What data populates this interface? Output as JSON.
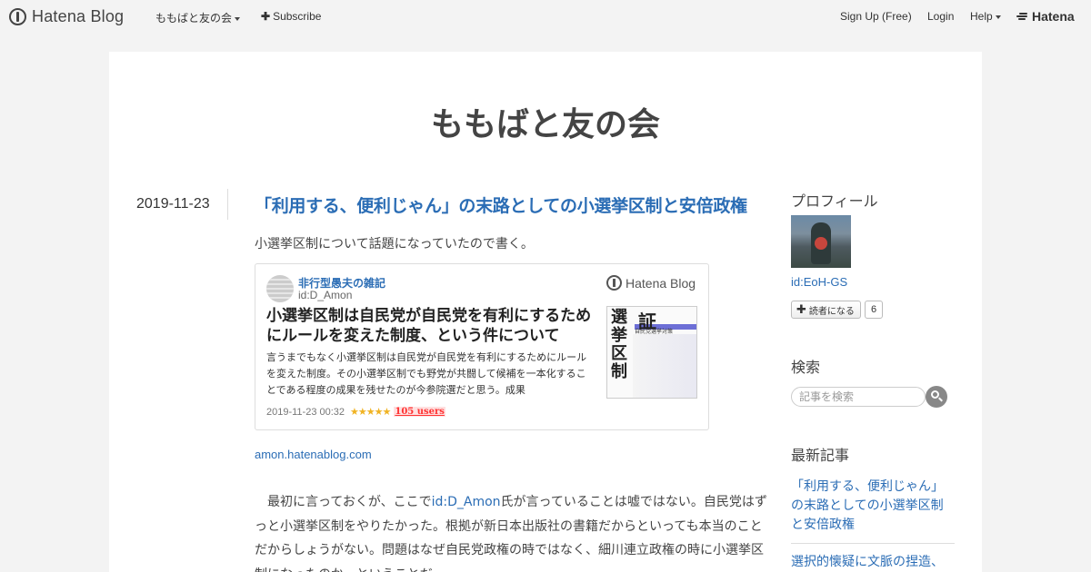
{
  "topbar": {
    "logo_text": "Hatena Blog",
    "blog_menu": "ももばと友の会",
    "subscribe": "Subscribe",
    "signup": "Sign Up (Free)",
    "login": "Login",
    "help": "Help",
    "hatena": "Hatena"
  },
  "blog": {
    "title": "ももばと友の会"
  },
  "entry": {
    "date": "2019-11-23",
    "title": "「利用する、便利じゃん」の末路としての小選挙区制と安倍政権",
    "intro": "小選挙区制について話題になっていたので書く。",
    "source_link": "amon.hatenablog.com",
    "body_before_link": "最初に言っておくが、ここで",
    "body_link": "id:D_Amon",
    "body_after_link": "氏が言っていることは嘘ではない。自民党はずっと小選挙区制をやりたかった。根拠が新日本出版社の書籍だからといっても本当のことだからしょうがない。問題はなぜ自民党政権の時ではなく、細川連立政権の時に小選挙区制になったのか、ということだ。"
  },
  "embed": {
    "blog_name": "非行型愚夫の雑記",
    "blog_id": "id:D_Amon",
    "logo_text": "Hatena Blog",
    "title": "小選挙区制は自民党が自民党を有利にするためにルールを変えた制度、という件について",
    "description": "言うまでもなく小選挙区制は自民党が自民党を有利にするためにルールを変えた制度。その小選挙区制でも野党が共闘して候補を一本化することである程度の成果を残せたのが今参院選だと思う。成果",
    "thumb_big1": "選挙区制",
    "thumb_big2": "証",
    "thumb_small": "自民党選挙対策",
    "timestamp": "2019-11-23 00:32",
    "stars": "★★★★★",
    "users": "105 users"
  },
  "sidebar": {
    "profile_heading": "プロフィール",
    "profile_id": "id:EoH-GS",
    "subscribe_label": "読者になる",
    "subscriber_count": "6",
    "search_heading": "検索",
    "search_placeholder": "記事を検索",
    "recent_heading": "最新記事",
    "recent_items": [
      "「利用する、便利じゃん」の末路としての小選挙区制と安倍政権",
      "選択的懐疑に文脈の捏造、"
    ]
  }
}
